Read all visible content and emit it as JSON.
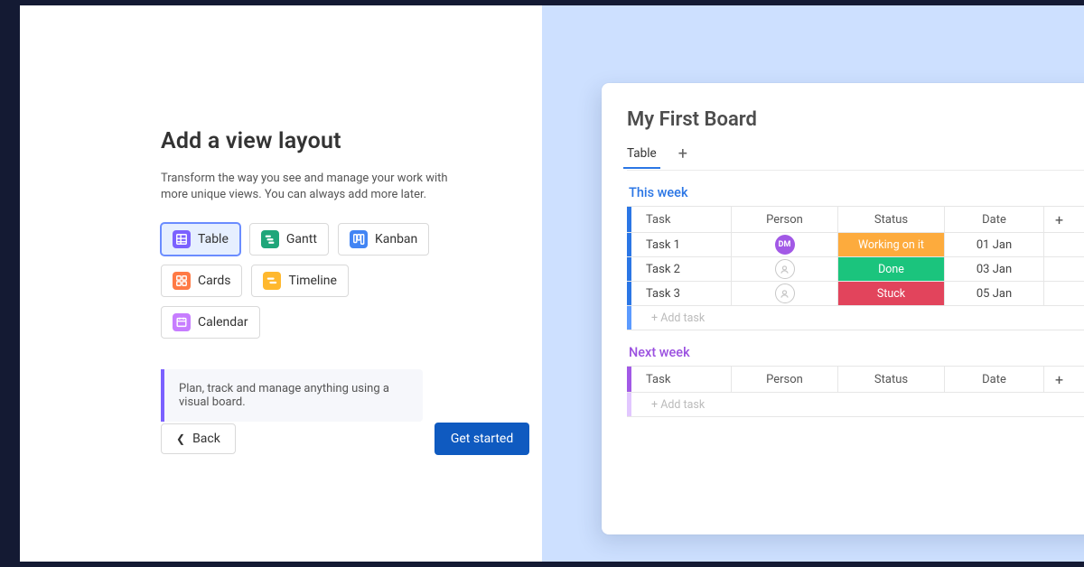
{
  "left": {
    "title": "Add a view layout",
    "subtitle": "Transform the way you see and manage your work with more unique views. You can always add more later.",
    "options": [
      {
        "label": "Table",
        "color": "#7b61ff",
        "selected": true
      },
      {
        "label": "Gantt",
        "color": "#1fa67a"
      },
      {
        "label": "Kanban",
        "color": "#4285f4"
      },
      {
        "label": "Cards",
        "color": "#ff7a45"
      },
      {
        "label": "Timeline",
        "color": "#ffb82e"
      },
      {
        "label": "Calendar",
        "color": "#c77dff"
      }
    ],
    "hint": "Plan, track and manage anything using a visual board.",
    "back": "Back",
    "cta": "Get started"
  },
  "board": {
    "title": "My First Board",
    "tab": "Table",
    "groups": [
      {
        "name": "This week",
        "color": "blue",
        "rows": [
          {
            "task": "Task 1",
            "person": "DM",
            "status": "Working on it",
            "status_color": "s-orange",
            "date": "01 Jan"
          },
          {
            "task": "Task 2",
            "person": "",
            "status": "Done",
            "status_color": "s-green",
            "date": "03 Jan"
          },
          {
            "task": "Task 3",
            "person": "",
            "status": "Stuck",
            "status_color": "s-red",
            "date": "05 Jan"
          }
        ]
      },
      {
        "name": "Next week",
        "color": "purple",
        "rows": []
      }
    ],
    "headers": {
      "task": "Task",
      "person": "Person",
      "status": "Status",
      "date": "Date"
    },
    "add_task": "+ Add task"
  }
}
